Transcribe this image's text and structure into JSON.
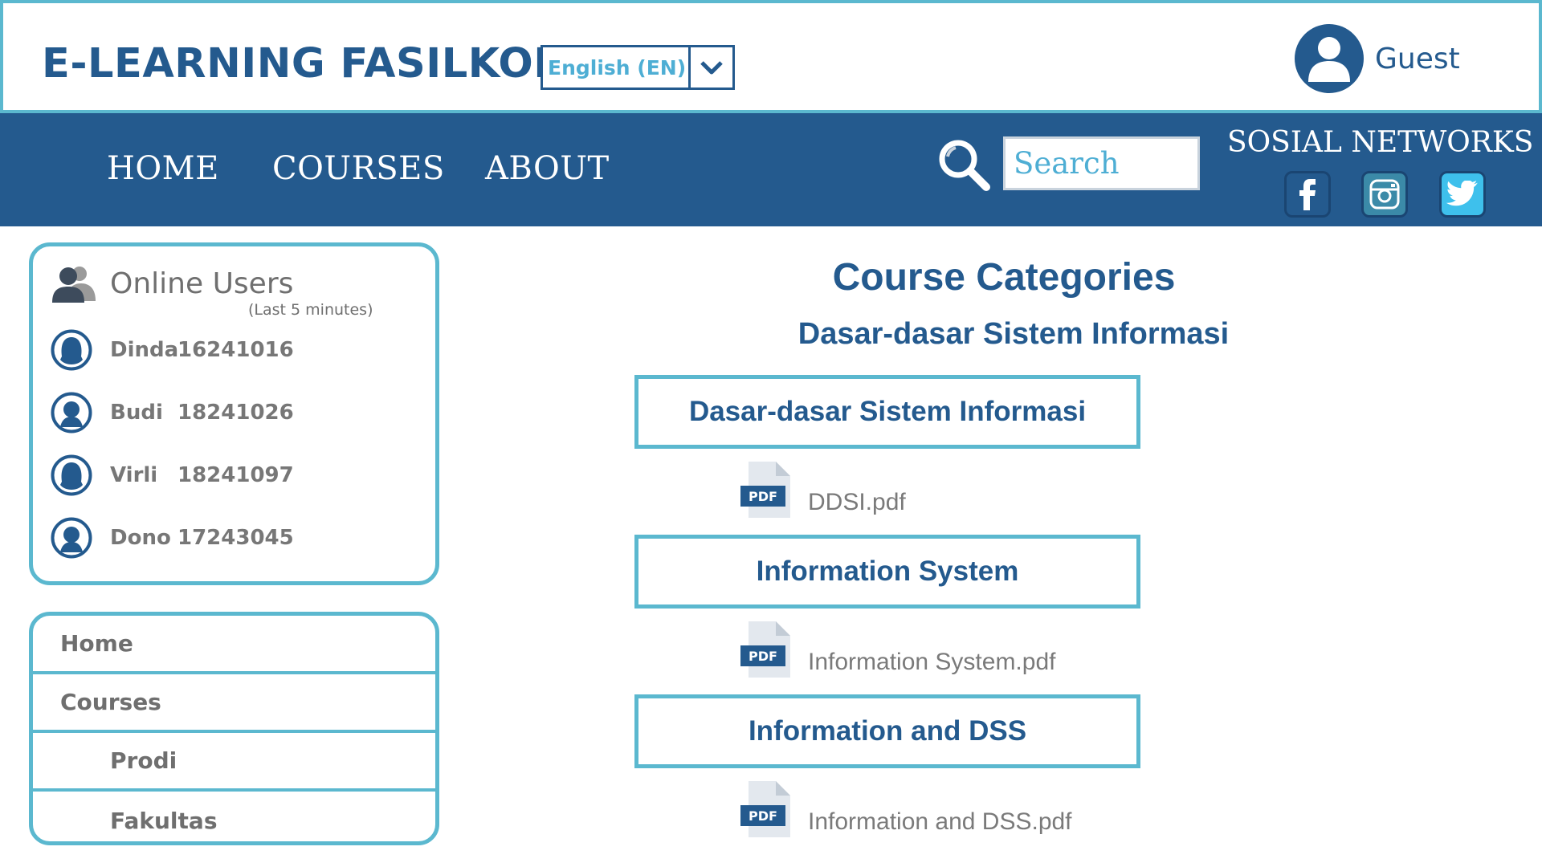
{
  "header": {
    "brand": "E-LEARNING FASILKOM",
    "language": {
      "selected": "English (EN)"
    },
    "user": {
      "name": "Guest"
    }
  },
  "nav": {
    "items": [
      {
        "label": "HOME"
      },
      {
        "label": "COURSES"
      },
      {
        "label": "ABOUT"
      }
    ],
    "search": {
      "placeholder": "Search"
    },
    "social": {
      "title": "SOSIAL NETWORKS",
      "icons": [
        "facebook-icon",
        "instagram-icon",
        "twitter-icon"
      ]
    }
  },
  "online_users": {
    "title": "Online Users",
    "subtitle": "(Last 5 minutes)",
    "users": [
      {
        "name": "Dinda",
        "id": "16241016"
      },
      {
        "name": "Budi",
        "id": "18241026"
      },
      {
        "name": "Virli",
        "id": "18241097"
      },
      {
        "name": "Dono",
        "id": "17243045"
      }
    ]
  },
  "side_menu": {
    "items": [
      {
        "label": "Home"
      },
      {
        "label": "Courses"
      },
      {
        "label": "Prodi"
      },
      {
        "label": "Fakultas"
      }
    ]
  },
  "main": {
    "title": "Course Categories",
    "subtitle": "Dasar-dasar Sistem Informasi",
    "categories": [
      {
        "label": "Dasar-dasar Sistem Informasi",
        "file": "DDSI.pdf"
      },
      {
        "label": "Information System",
        "file": "Information System.pdf"
      },
      {
        "label": "Information and DSS",
        "file": "Information and DSS.pdf"
      }
    ],
    "pdf_badge": "PDF"
  },
  "colors": {
    "primary": "#245a8e",
    "accent": "#5bb8cf",
    "muted_text": "#6f6f6f"
  }
}
